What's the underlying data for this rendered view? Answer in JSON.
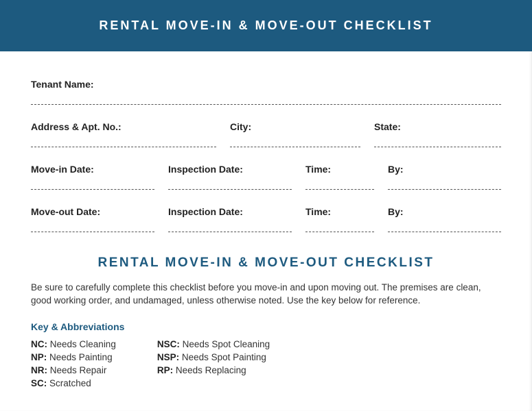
{
  "header": {
    "title": "RENTAL MOVE-IN & MOVE-OUT CHECKLIST"
  },
  "fields": {
    "tenant_name": "Tenant Name:",
    "address": "Address & Apt. No.:",
    "city": "City:",
    "state": "State:",
    "move_in_date": "Move-in Date:",
    "move_out_date": "Move-out Date:",
    "inspection_date": "Inspection Date:",
    "time": "Time:",
    "by": "By:"
  },
  "section": {
    "title": "RENTAL MOVE-IN & MOVE-OUT CHECKLIST",
    "intro": "Be sure to carefully complete this checklist before you move-in and upon moving out. The premises are clean, good working order, and undamaged, unless otherwise noted. Use the key below for reference.",
    "key_heading": "Key & Abbreviations"
  },
  "abbrev": {
    "col1": [
      {
        "code": "NC:",
        "desc": "Needs Cleaning"
      },
      {
        "code": "NP:",
        "desc": "Needs Painting"
      },
      {
        "code": "NR:",
        "desc": "Needs Repair"
      },
      {
        "code": "SC:",
        "desc": "Scratched"
      }
    ],
    "col2": [
      {
        "code": "NSC:",
        "desc": "Needs Spot Cleaning"
      },
      {
        "code": "NSP:",
        "desc": "Needs Spot Painting"
      },
      {
        "code": "RP:",
        "desc": "Needs Replacing"
      }
    ]
  }
}
